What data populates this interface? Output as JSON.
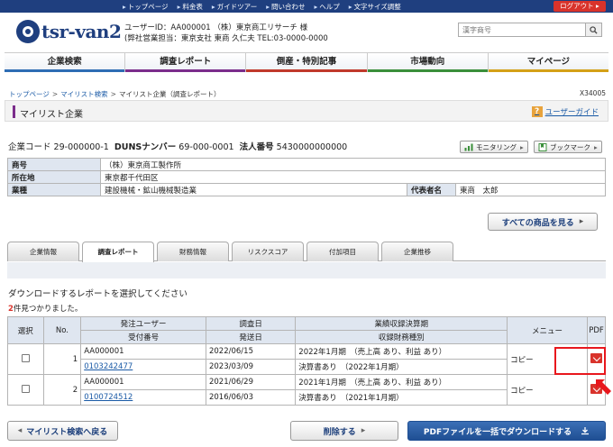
{
  "utility_links": [
    "トップページ",
    "料金表",
    "ガイドツアー",
    "問い合わせ",
    "ヘルプ",
    "文字サイズ調整"
  ],
  "logout_label": "ログアウト",
  "logo_text": "tsr-van2",
  "user": {
    "line1": "ユーザーID：AA000001 （株）東京商工リサーチ 様",
    "line2": "(弊社営業担当：東京支社 東商 久仁夫 TEL:03-0000-0000"
  },
  "search": {
    "placeholder": "漢字商号"
  },
  "nav": [
    {
      "label": "企業検索",
      "color": "#2e6db4"
    },
    {
      "label": "調査レポート",
      "color": "#7b2d8b"
    },
    {
      "label": "倒産・特別記事",
      "color": "#c0392b"
    },
    {
      "label": "市場動向",
      "color": "#3a8f3a"
    },
    {
      "label": "マイページ",
      "color": "#d4a017"
    }
  ],
  "breadcrumb": [
    "トップページ",
    "マイリスト検索",
    "マイリスト企業（調査レポート）"
  ],
  "page_code": "X34005",
  "page_title": "マイリスト企業",
  "user_guide": "ユーザーガイド",
  "company": {
    "code_label": "企業コード",
    "code": "29-000000-1",
    "duns_label": "DUNSナンバー",
    "duns": "69-000-0001",
    "corp_label": "法人番号",
    "corp": "5430000000000"
  },
  "monitoring_label": "モニタリング",
  "bookmark_label": "ブックマーク",
  "info": {
    "name_label": "商号",
    "name": "（株）東京商工製作所",
    "address_label": "所在地",
    "address": "東京都千代田区",
    "industry_label": "業種",
    "industry": "建設機械・鉱山機械製造業",
    "rep_label": "代表者名",
    "rep": "東商　太郎"
  },
  "all_products_label": "すべての商品を見る",
  "tabs": [
    "企業情報",
    "調査レポート",
    "財務情報",
    "リスクスコア",
    "付加項目",
    "企業推移"
  ],
  "instruction": "ダウンロードするレポートを選択してください",
  "found": {
    "count": "2",
    "suffix": "件見つかりました。"
  },
  "table": {
    "headers": {
      "select": "選択",
      "no": "No.",
      "issuer": "発注ユーザー",
      "receipt": "受付番号",
      "survey_date": "調査日",
      "sent_date": "発送日",
      "period": "業績収録決算期",
      "fin_type": "収録財務種別",
      "menu": "メニュー",
      "pdf": "PDF"
    },
    "rows": [
      {
        "no": "1",
        "issuer": "AA000001",
        "receipt": "0103242477",
        "survey_date": "2022/06/15",
        "sent_date": "2023/03/09",
        "period": "2022年1月期　（売上高 あり、利益 あり）",
        "fin_type": "決算書あり　（2022年1月期）",
        "menu": "コピー"
      },
      {
        "no": "2",
        "issuer": "AA000001",
        "receipt": "0100724512",
        "survey_date": "2021/06/29",
        "sent_date": "2016/06/03",
        "period": "2021年1月期　（売上高 あり、利益 あり）",
        "fin_type": "決算書あり　（2021年1月期）",
        "menu": "コピー"
      }
    ]
  },
  "buttons": {
    "back": "マイリスト検索へ戻る",
    "delete": "削除する",
    "download_all": "PDFファイルを一括でダウンロードする"
  }
}
